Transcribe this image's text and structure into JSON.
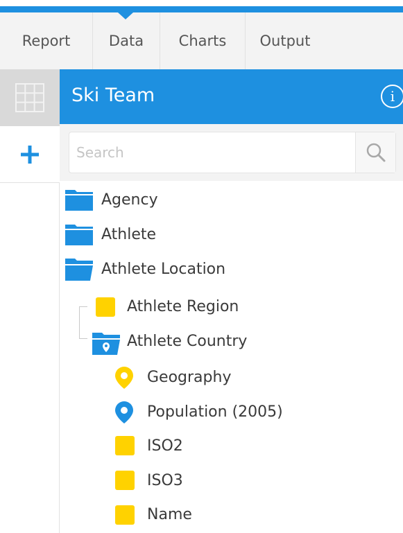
{
  "tabs": [
    {
      "label": "Report"
    },
    {
      "label": "Data"
    },
    {
      "label": "Charts"
    },
    {
      "label": "Output"
    }
  ],
  "header": {
    "title": "Ski Team"
  },
  "search": {
    "placeholder": "Search",
    "value": ""
  },
  "tree": {
    "folders": [
      {
        "label": "Agency"
      },
      {
        "label": "Athlete"
      },
      {
        "label": "Athlete Location"
      }
    ],
    "region": {
      "label": "Athlete Region"
    },
    "country": {
      "label": "Athlete Country"
    },
    "fields": [
      {
        "label": "Geography"
      },
      {
        "label": "Population (2005)"
      },
      {
        "label": "ISO2"
      },
      {
        "label": "ISO3"
      },
      {
        "label": "Name"
      }
    ]
  },
  "colors": {
    "accent": "#1e90e0",
    "dimension": "#ffd200",
    "measure": "#1e90e0"
  },
  "icons": [
    "grid-icon",
    "plus-icon",
    "info-icon",
    "search-icon",
    "folder-icon",
    "geo-folder-icon",
    "location-pin-icon"
  ]
}
